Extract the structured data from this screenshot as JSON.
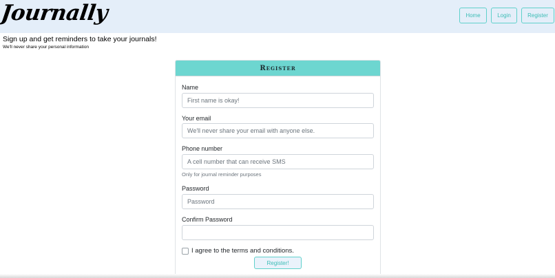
{
  "header": {
    "logo": "Journally",
    "nav": {
      "home": "Home",
      "login": "Login",
      "register": "Register"
    }
  },
  "intro": {
    "tagline": "Sign up and get reminders to take your journals!",
    "subtext": "We'll never share your personal information"
  },
  "form": {
    "title": "Register",
    "name_label": "Name",
    "name_placeholder": "First name is okay!",
    "email_label": "Your email",
    "email_placeholder": "We'll never share your email with anyone else.",
    "phone_label": "Phone number",
    "phone_placeholder": "A cell number that can receive SMS",
    "phone_help": "Only for journal reminder purposes",
    "password_label": "Password",
    "password_placeholder": "Password",
    "confirm_label": "Confirm Password",
    "confirm_placeholder": "",
    "terms_label": "I agree to the terms and conditions.",
    "terms_checked": false,
    "submit_label": "Register!"
  },
  "colors": {
    "navbar_bg": "#e4eef9",
    "accent_teal": "#6dd6d0",
    "button_border": "#5fd1cb",
    "button_text": "#3cbdb6"
  }
}
